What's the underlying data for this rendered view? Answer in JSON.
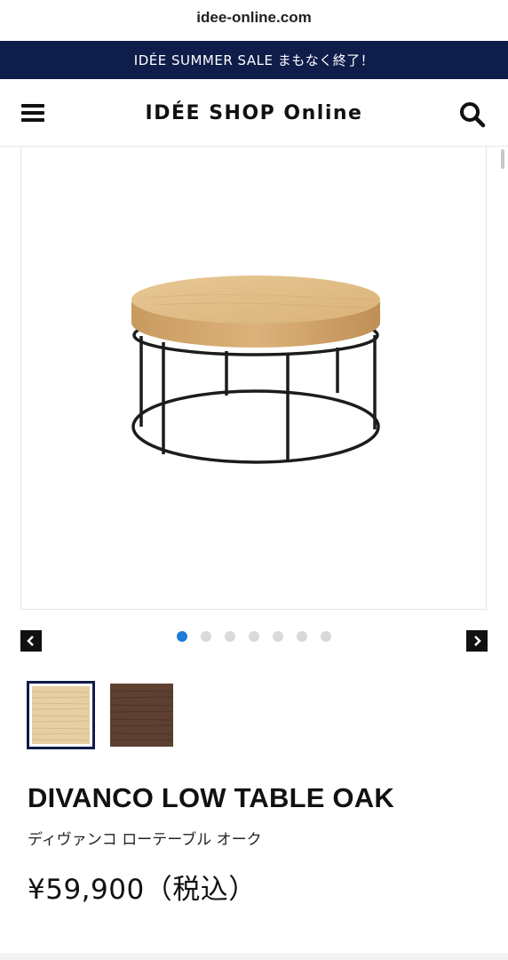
{
  "browser": {
    "url": "idee-online.com"
  },
  "banner": {
    "text": "IDÉE SUMMER SALE まもなく終了！"
  },
  "header": {
    "logo": "IDÉE SHOP Online",
    "menu_icon": "hamburger-menu-icon",
    "search_icon": "search-icon"
  },
  "gallery": {
    "total_slides": 7,
    "active_slide": 1,
    "prev_icon": "chevron-left-icon",
    "next_icon": "chevron-right-icon",
    "image": "round-oak-low-table-with-black-steel-frame"
  },
  "swatches": [
    {
      "name": "oak",
      "color": "#e2c89a",
      "selected": true
    },
    {
      "name": "walnut",
      "color": "#5b3e2d",
      "selected": false
    }
  ],
  "product": {
    "title": "DIVANCO LOW TABLE OAK",
    "subtitle": "ディヴァンコ ローテーブル オーク",
    "price": "¥59,900（税込）"
  },
  "colors": {
    "banner_bg": "#0f1d4a",
    "dot_active": "#1e7bd6",
    "dot_inactive": "#d9d9d9"
  }
}
